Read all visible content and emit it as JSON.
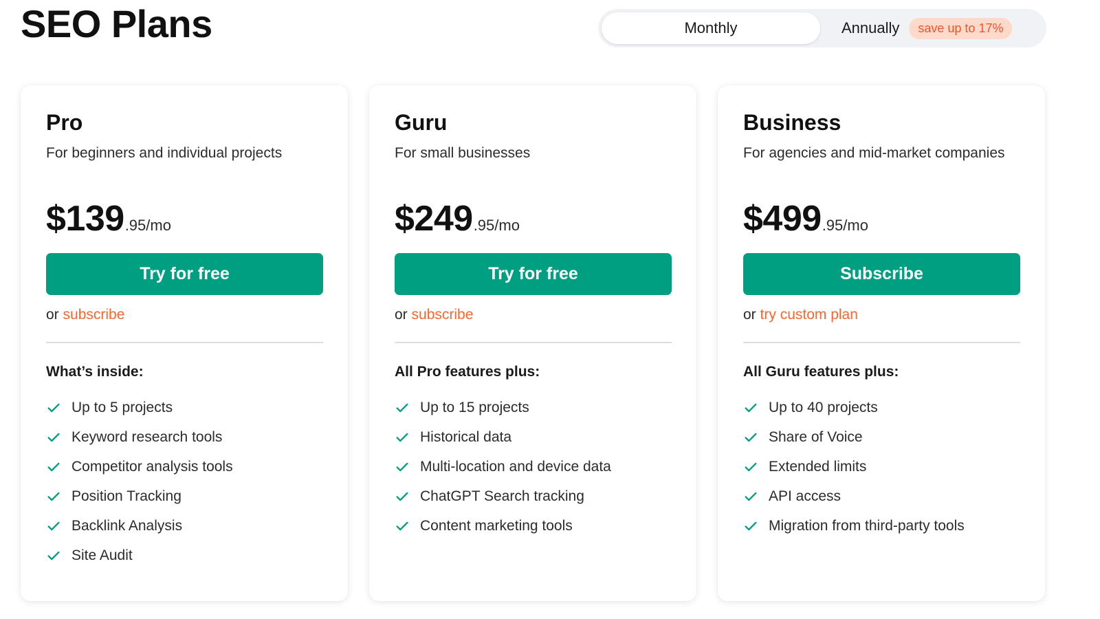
{
  "page": {
    "title": "SEO Plans"
  },
  "billing_toggle": {
    "monthly_label": "Monthly",
    "annually_label": "Annually",
    "save_badge": "save up to 17%",
    "selected": "Monthly"
  },
  "colors": {
    "accent_green": "#009f81",
    "link_orange": "#ff642d",
    "badge_bg": "#ffd9c9",
    "badge_text": "#f0552b"
  },
  "plans": [
    {
      "name": "Pro",
      "description": "For beginners and individual projects",
      "price_main": "$139",
      "price_cents": ".95/mo",
      "cta_label": "Try for free",
      "alt_prefix": "or",
      "alt_link": "subscribe",
      "features_heading": "What’s inside:",
      "features": [
        "Up to 5 projects",
        "Keyword research tools",
        "Competitor analysis tools",
        "Position Tracking",
        "Backlink Analysis",
        "Site Audit"
      ]
    },
    {
      "name": "Guru",
      "description": "For small businesses",
      "price_main": "$249",
      "price_cents": ".95/mo",
      "cta_label": "Try for free",
      "alt_prefix": "or",
      "alt_link": "subscribe",
      "features_heading": "All Pro features plus:",
      "features": [
        "Up to 15 projects",
        "Historical data",
        "Multi-location and device data",
        "ChatGPT Search tracking",
        "Content marketing tools"
      ]
    },
    {
      "name": "Business",
      "description": "For agencies and mid-market companies",
      "price_main": "$499",
      "price_cents": ".95/mo",
      "cta_label": "Subscribe",
      "alt_prefix": "or",
      "alt_link": "try custom plan",
      "features_heading": "All Guru features plus:",
      "features": [
        "Up to 40 projects",
        "Share of Voice",
        "Extended limits",
        "API access",
        "Migration from third-party tools"
      ]
    }
  ],
  "icons": {
    "feature_bullet": "check-icon"
  }
}
